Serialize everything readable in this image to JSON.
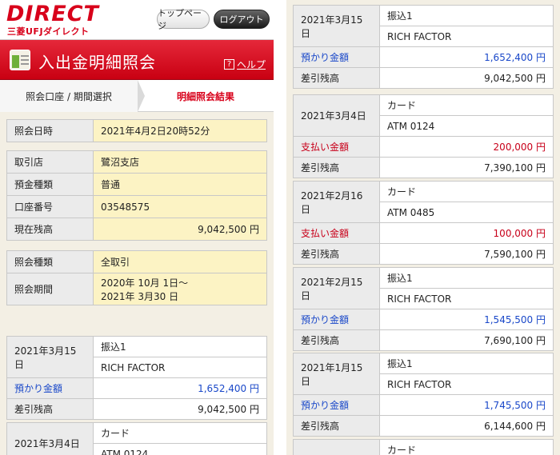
{
  "header": {
    "logo_main": "DIRECT",
    "logo_sub": "三菱UFJダイレクト",
    "top_page_label": "トップページ",
    "logout_label": "ログアウト"
  },
  "title": {
    "text": "入出金明細照会",
    "help_glyph": "?",
    "help_label": "ヘルプ"
  },
  "steps": {
    "step1": "照会口座 / 期間選択",
    "step2": "明細照会結果"
  },
  "inquiry": {
    "datetime_label": "照会日時",
    "datetime_value": "2021年4月2日20時52分"
  },
  "account": {
    "branch_label": "取引店",
    "branch_value": "鷺沼支店",
    "type_label": "預金種類",
    "type_value": "普通",
    "number_label": "口座番号",
    "number_value": "03548575",
    "balance_label": "現在残高",
    "balance_value": "9,042,500 円"
  },
  "criteria": {
    "kind_label": "照会種類",
    "kind_value": "全取引",
    "period_label": "照会期間",
    "period_from": "2020年 10月 1日～",
    "period_to": "2021年 3月30 日"
  },
  "transactions": [
    {
      "date": "2021年3月15日",
      "type": "振込1",
      "desc": "RICH FACTOR",
      "amount_label": "預かり金額",
      "amount": "1,652,400 円",
      "balance_label": "差引残高",
      "balance": "9,042,500 円",
      "kind": "deposit"
    },
    {
      "date": "2021年3月4日",
      "type": "カード",
      "desc": "ATM 0124",
      "amount_label": "支払い金額",
      "amount": "200,000 円",
      "balance_label": "差引残高",
      "balance": "7,390,100 円",
      "kind": "withdrawal"
    },
    {
      "date": "2021年2月16日",
      "type": "カード",
      "desc": "ATM 0485",
      "amount_label": "支払い金額",
      "amount": "100,000 円",
      "balance_label": "差引残高",
      "balance": "7,590,100 円",
      "kind": "withdrawal"
    },
    {
      "date": "2021年2月15日",
      "type": "振込1",
      "desc": "RICH FACTOR",
      "amount_label": "預かり金額",
      "amount": "1,545,500 円",
      "balance_label": "差引残高",
      "balance": "7,690,100 円",
      "kind": "deposit"
    },
    {
      "date": "2021年1月15日",
      "type": "振込1",
      "desc": "RICH FACTOR",
      "amount_label": "預かり金額",
      "amount": "1,745,500 円",
      "balance_label": "差引残高",
      "balance": "6,144,600 円",
      "kind": "deposit"
    },
    {
      "type": "カード"
    }
  ],
  "colors": {
    "brand_red": "#d8001a",
    "deposit_blue": "#1a48c9",
    "withdrawal_red": "#c8001a",
    "value_yellow": "#fcf3c4"
  },
  "icons": [
    "statement-icon",
    "help-icon"
  ]
}
